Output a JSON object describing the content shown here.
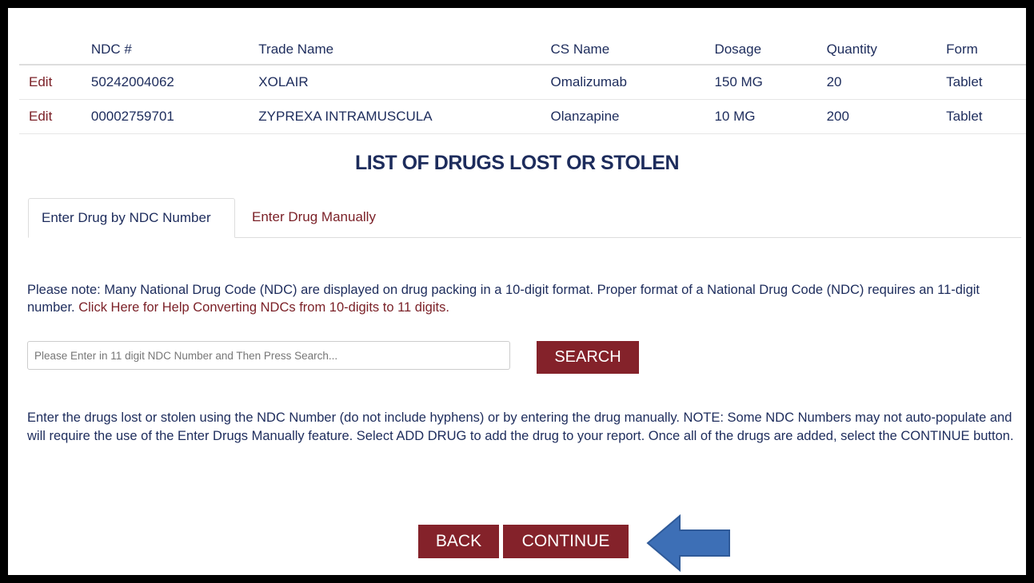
{
  "drug_table": {
    "headers": [
      "",
      "NDC #",
      "Trade Name",
      "CS Name",
      "Dosage",
      "Quantity",
      "Form"
    ],
    "rows": [
      {
        "edit": "Edit",
        "ndc": "50242004062",
        "trade_name": "XOLAIR",
        "cs_name": "Omalizumab",
        "dosage": "150 MG",
        "quantity": "20",
        "form": "Tablet"
      },
      {
        "edit": "Edit",
        "ndc": "00002759701",
        "trade_name": "ZYPREXA INTRAMUSCULA",
        "cs_name": "Olanzapine",
        "dosage": "10 MG",
        "quantity": "200",
        "form": "Tablet"
      }
    ]
  },
  "section_title": "LIST OF DRUGS LOST OR STOLEN",
  "tabs": [
    {
      "label": "Enter Drug by NDC Number",
      "active": true
    },
    {
      "label": "Enter Drug Manually",
      "active": false
    }
  ],
  "note": {
    "text": "Please note: Many National Drug Code (NDC) are displayed on drug packing in a 10-digit format. Proper format of a National Drug Code (NDC) requires an 11-digit number. ",
    "link_text": "Click Here for Help Converting NDCs from 10-digits to 11 digits."
  },
  "search": {
    "placeholder": "Please Enter in 11 digit NDC Number and Then Press Search...",
    "value": "",
    "button_label": "SEARCH"
  },
  "instructions": "Enter the drugs lost or stolen using the NDC Number (do not include hyphens) or by entering the drug manually. NOTE: Some NDC Numbers may not auto-populate and will require the use of the Enter Drugs Manually feature. Select ADD DRUG to add the drug to your report. Once all of the drugs are added, select the CONTINUE button.",
  "buttons": {
    "back_label": "BACK",
    "continue_label": "CONTINUE"
  },
  "icons": {
    "pointer_arrow": "left-arrow-icon"
  },
  "colors": {
    "brand_maroon": "#84222a",
    "text_navy": "#1d2c5c",
    "link_maroon": "#7a1f26",
    "arrow_blue": "#3d6fb6"
  }
}
